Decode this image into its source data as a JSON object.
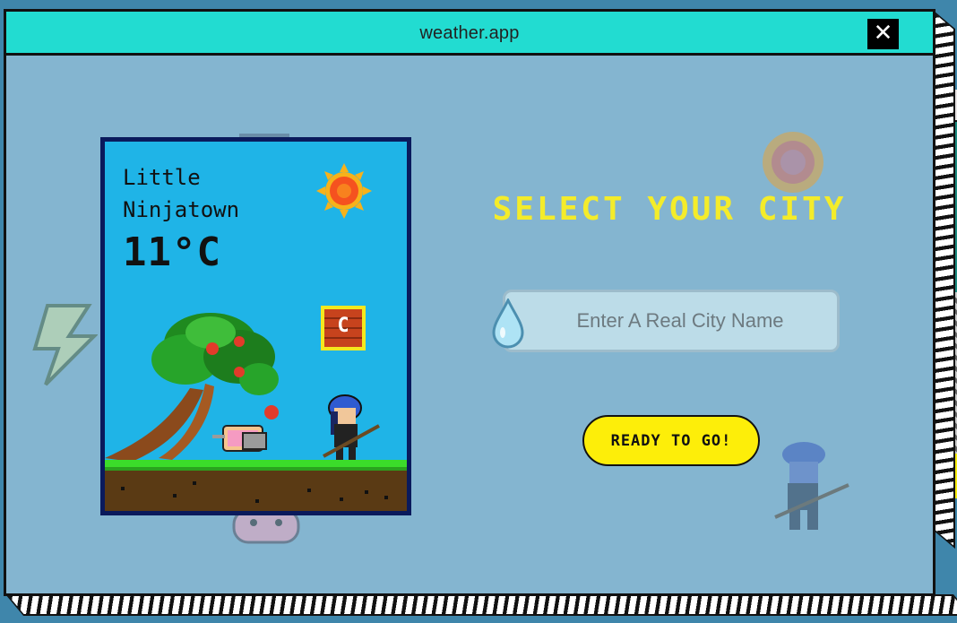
{
  "window": {
    "title": "weather.app",
    "close_glyph": "✕"
  },
  "card": {
    "city": "Little Ninjatown",
    "temperature": "11°C",
    "weather_icon": "sun-icon",
    "unit_badge": "C"
  },
  "main": {
    "heading": "SELECT YOUR CITY",
    "search": {
      "placeholder": "Enter A Real City Name",
      "value": ""
    },
    "go_button": "READY TO GO!"
  },
  "colors": {
    "titlebar": "#22dcd1",
    "window_bg": "#84b5d0",
    "card_bg": "#1fb4e7",
    "heading": "#f4ec2a",
    "button": "#fdee09"
  }
}
